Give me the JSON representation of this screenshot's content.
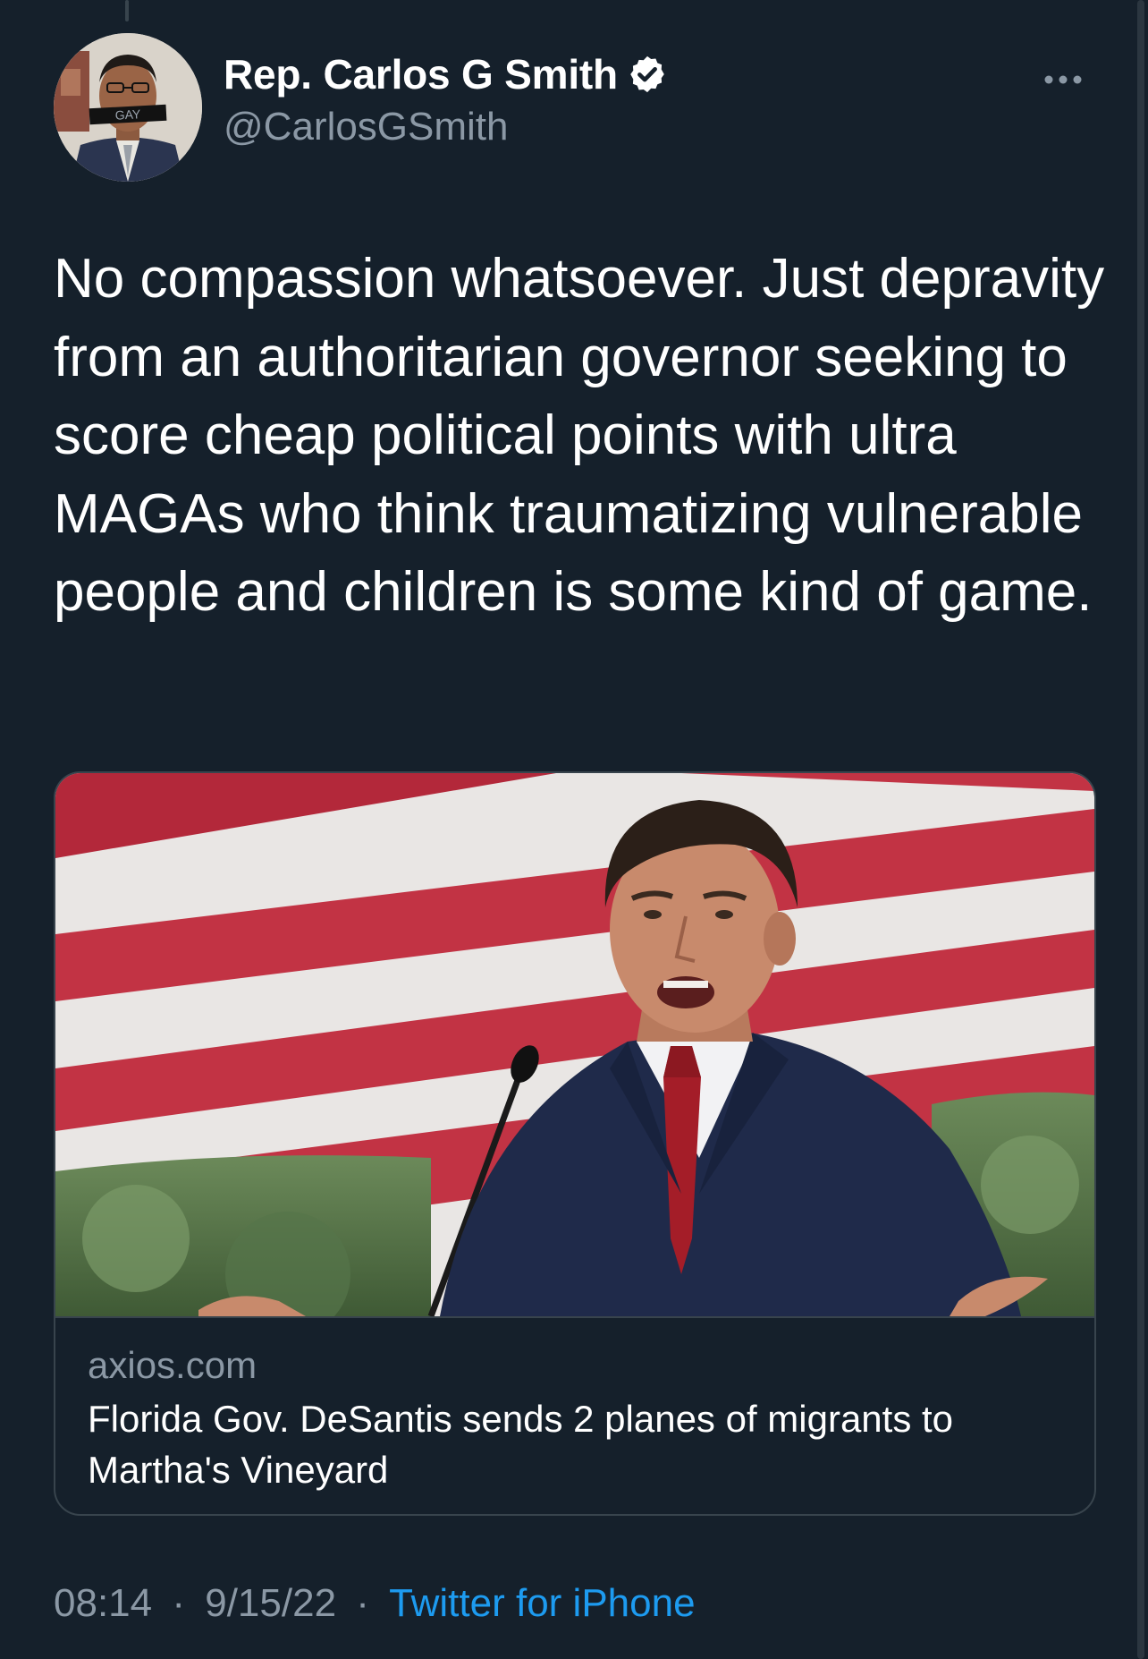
{
  "tweet": {
    "author": {
      "display_name": "Rep. Carlos G Smith",
      "handle": "@CarlosGSmith",
      "verified": true,
      "avatar_text": "GAY"
    },
    "text": "No compassion whatsoever. Just depravity from an authoritarian governor seeking to score cheap political points with ultra MAGAs who think traumatizing vulnerable people and children is some kind of game.",
    "card": {
      "domain": "axios.com",
      "title": "Florida Gov. DeSantis sends 2 planes of migrants to Martha's Vineyard",
      "image_icon": "photo-man-at-podium"
    },
    "meta": {
      "time": "08:14",
      "separator": "·",
      "date": "9/15/22",
      "source": "Twitter for iPhone"
    },
    "icons": {
      "more": "more-horizontal-icon",
      "verified": "verified-badge-icon"
    },
    "colors": {
      "background": "#15202b",
      "secondary_text": "#8b98a5",
      "accent": "#1d9bf0",
      "border": "#38444d"
    }
  }
}
